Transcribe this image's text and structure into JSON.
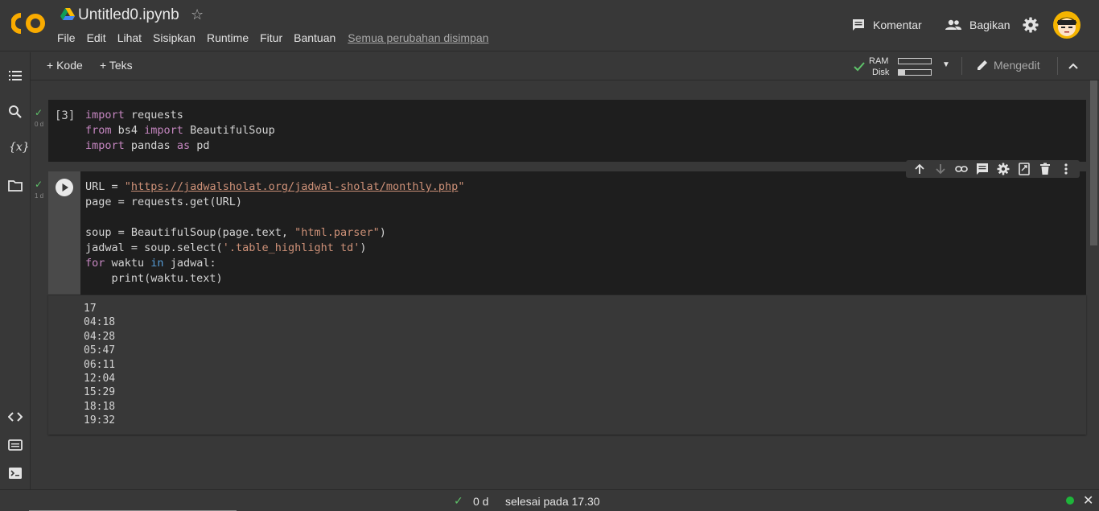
{
  "header": {
    "title": "Untitled0.ipynb",
    "menu": [
      "File",
      "Edit",
      "Lihat",
      "Sisipkan",
      "Runtime",
      "Fitur",
      "Bantuan"
    ],
    "saved_status": "Semua perubahan disimpan",
    "komentar": "Komentar",
    "bagikan": "Bagikan"
  },
  "toolbar": {
    "add_code": "+ Kode",
    "add_text": "+ Teks",
    "ram_label": "RAM",
    "disk_label": "Disk",
    "ram_usage": 0.0,
    "disk_usage": 0.2,
    "mengedit": "Mengedit"
  },
  "cells": [
    {
      "exec_count": "[3]",
      "duration": "0 d",
      "code_lines": [
        [
          [
            "kw",
            "import"
          ],
          [
            "t",
            " requests"
          ]
        ],
        [
          [
            "kw",
            "from"
          ],
          [
            "t",
            " bs4 "
          ],
          [
            "kw",
            "import"
          ],
          [
            "t",
            " BeautifulSoup"
          ]
        ],
        [
          [
            "kw",
            "import"
          ],
          [
            "t",
            " pandas "
          ],
          [
            "kw",
            "as"
          ],
          [
            "t",
            " pd"
          ]
        ]
      ]
    },
    {
      "duration": "1 d",
      "code_lines": [
        [
          [
            "t",
            "URL = "
          ],
          [
            "str",
            "\""
          ],
          [
            "url",
            "https://jadwalsholat.org/jadwal-sholat/monthly.php"
          ],
          [
            "str",
            "\""
          ]
        ],
        [
          [
            "t",
            "page = requests.get(URL)"
          ]
        ],
        [
          [
            "t",
            ""
          ]
        ],
        [
          [
            "t",
            "soup = BeautifulSoup(page.text, "
          ],
          [
            "str",
            "\"html.parser\""
          ],
          [
            "t",
            ")"
          ]
        ],
        [
          [
            "t",
            "jadwal = soup.select("
          ],
          [
            "str",
            "'.table_highlight td'"
          ],
          [
            "t",
            ")"
          ]
        ],
        [
          [
            "kw",
            "for"
          ],
          [
            "t",
            " waktu "
          ],
          [
            "kw2",
            "in"
          ],
          [
            "t",
            " jadwal:"
          ]
        ],
        [
          [
            "t",
            "    print(waktu.text)"
          ]
        ]
      ],
      "output": [
        "17",
        "04:18",
        "04:28",
        "05:47",
        "06:11",
        "12:04",
        "15:29",
        "18:18",
        "19:32"
      ]
    }
  ],
  "statusbar": {
    "duration": "0 d",
    "text": "selesai pada 17.30"
  },
  "colors": {
    "accent_check": "#5ec269",
    "connected": "#1eb53a",
    "keyword": "#c586c0",
    "string": "#ce9178"
  }
}
